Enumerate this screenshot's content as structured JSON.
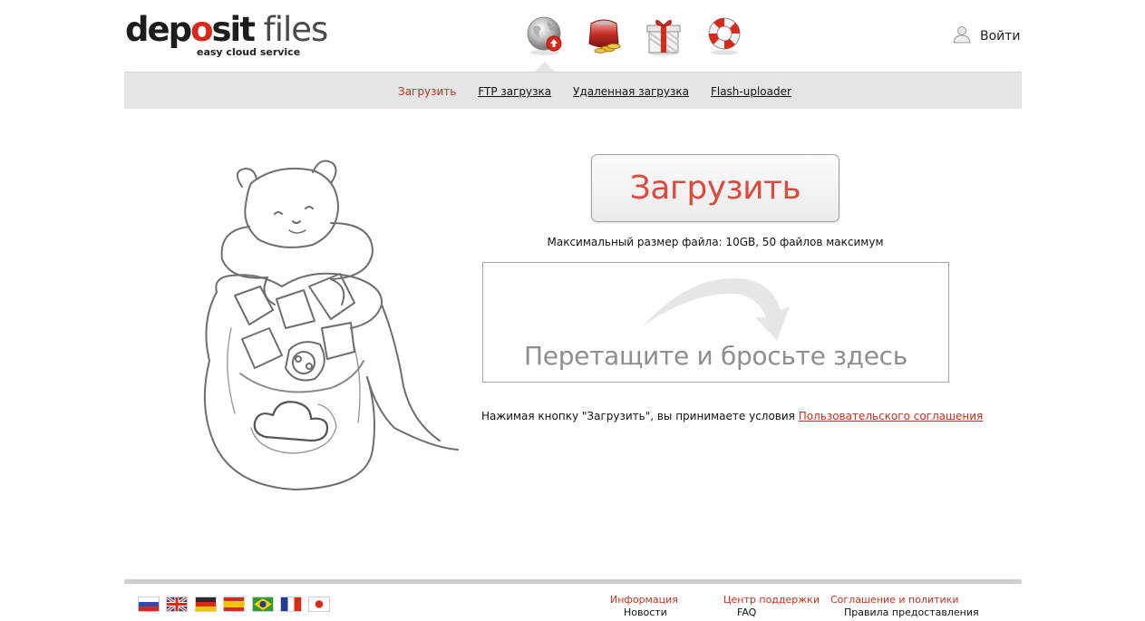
{
  "header": {
    "logo": {
      "part1": "dep",
      "part2": "o",
      "part3": "sit",
      "part4": " files",
      "tagline": "easy cloud service"
    },
    "icons": [
      {
        "name": "upload-globe-icon"
      },
      {
        "name": "wallet-coins-icon"
      },
      {
        "name": "gift-icon"
      },
      {
        "name": "lifebuoy-icon"
      }
    ],
    "login_label": "Войти"
  },
  "subnav": {
    "items": [
      {
        "label": "Загрузить",
        "active": true
      },
      {
        "label": "FTP загрузка",
        "active": false
      },
      {
        "label": "Удаленная загрузка",
        "active": false
      },
      {
        "label": "Flash-uploader",
        "active": false
      }
    ]
  },
  "main": {
    "upload_button_label": "Загрузить",
    "max_size_text": "Максимальный размер файла: 10GB, 50 файлов максимум",
    "drop_zone_text": "Перетащите и бросьте здесь",
    "terms_prefix": "Нажимая кнопку \"Загрузить\", вы принимаете условия ",
    "terms_link": "Пользовательского соглашения"
  },
  "footer": {
    "languages": [
      "ru",
      "en",
      "de",
      "es",
      "pt-br",
      "fr",
      "ja"
    ],
    "columns": [
      {
        "heading": "Информация",
        "links": [
          "Новости"
        ]
      },
      {
        "heading": "Центр поддержки",
        "links": [
          "FAQ"
        ]
      },
      {
        "heading": "Соглашение и политики",
        "links": [
          "Правила предоставления"
        ]
      }
    ]
  },
  "colors": {
    "accent": "#c9301f",
    "upload_label": "#e04a3e",
    "nav_bg": "#e5e5e5",
    "drop_text": "#8e8e8e"
  }
}
